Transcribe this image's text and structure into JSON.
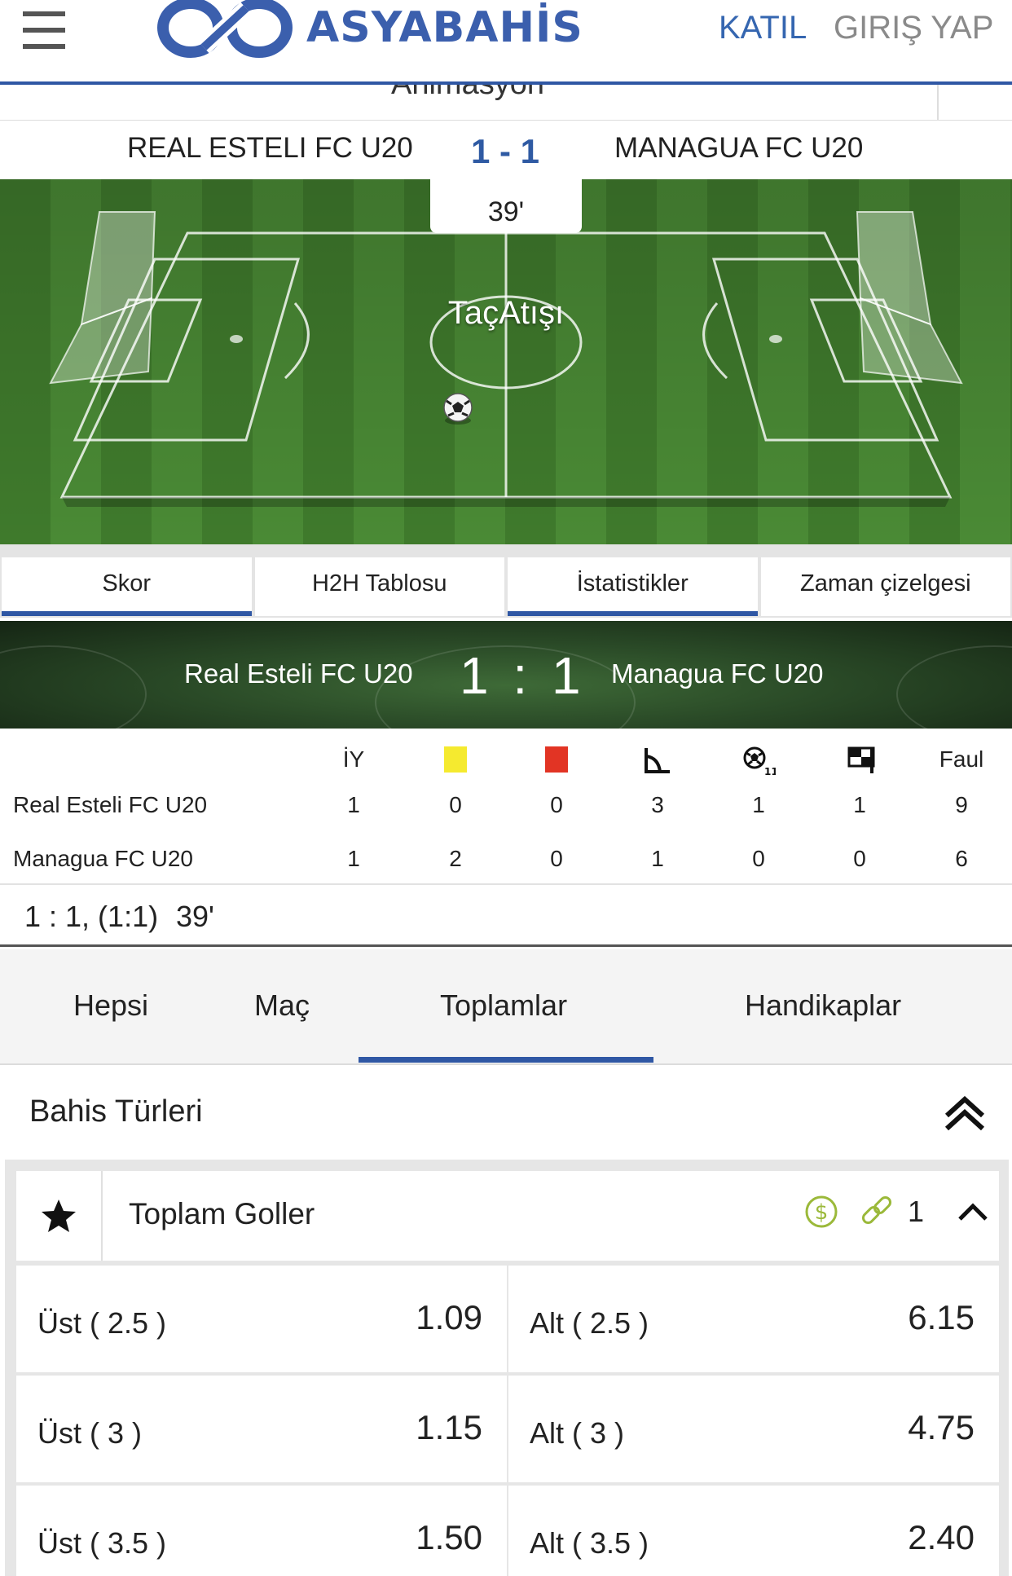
{
  "header": {
    "brand": "ASYABAHİS",
    "join": "KATIL",
    "login": "GIRIŞ YAP"
  },
  "animation_label": "Animasyon",
  "match": {
    "home": "REAL ESTELI FC U20",
    "away": "MANAGUA FC U20",
    "score": "1 - 1",
    "minute": "39'",
    "event": "TaçAtışı"
  },
  "tabs": [
    "Skor",
    "H2H Tablosu",
    "İstatistikler",
    "Zaman çizelgesi"
  ],
  "scoreboard": {
    "home": "Real Esteli FC U20",
    "away": "Managua FC U20",
    "score": "1 : 1"
  },
  "stats": {
    "headers": [
      "İY",
      "yellow-card-icon",
      "red-card-icon",
      "corner-icon",
      "penalty-icon",
      "offside-flag-icon",
      "Faul"
    ],
    "rows": [
      {
        "team": "Real Esteli FC U20",
        "values": [
          "1",
          "0",
          "0",
          "3",
          "1",
          "1",
          "9"
        ]
      },
      {
        "team": "Managua FC U20",
        "values": [
          "1",
          "2",
          "0",
          "1",
          "0",
          "0",
          "6"
        ]
      }
    ]
  },
  "result_line": {
    "text": "1 : 1, (1:1)",
    "minute": "39'"
  },
  "market_tabs": [
    "Hepsi",
    "Maç",
    "Toplamlar",
    "Handikaplar"
  ],
  "active_market_tab": "Toplamlar",
  "bet_types_label": "Bahis Türleri",
  "market": {
    "title": "Toplam Goller",
    "link_count": "1",
    "odds": [
      {
        "over_label": "Üst ( 2.5 )",
        "over": "1.09",
        "under_label": "Alt ( 2.5 )",
        "under": "6.15"
      },
      {
        "over_label": "Üst ( 3 )",
        "over": "1.15",
        "under_label": "Alt ( 3 )",
        "under": "4.75"
      },
      {
        "over_label": "Üst ( 3.5 )",
        "over": "1.50",
        "under_label": "Alt ( 3.5 )",
        "under": "2.40"
      }
    ]
  },
  "colors": {
    "brand_blue": "#2f57a4",
    "pitch_green": "#457f30",
    "odds_green_icon": "#9bb93a"
  }
}
